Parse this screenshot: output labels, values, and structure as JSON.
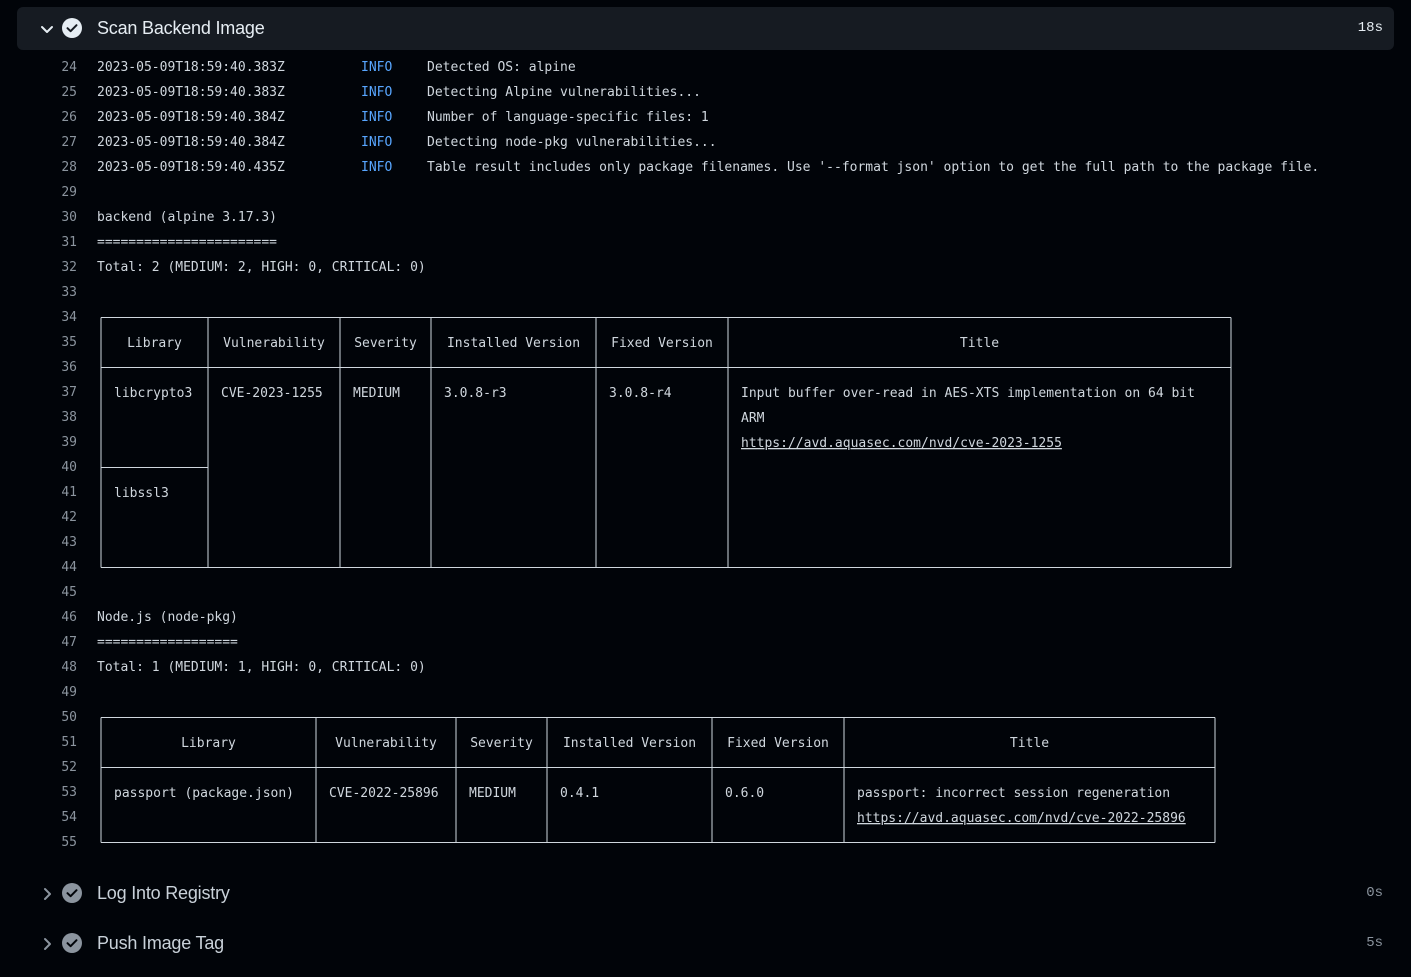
{
  "steps": {
    "active": {
      "title": "Scan Backend Image",
      "duration": "18s"
    },
    "next1": {
      "title": "Log Into Registry",
      "duration": "0s"
    },
    "next2": {
      "title": "Push Image Tag",
      "duration": "5s"
    }
  },
  "log": {
    "info_lines": [
      {
        "n": "24",
        "ts": "2023-05-09T18:59:40.383Z",
        "level": "INFO",
        "msg": "Detected OS: alpine"
      },
      {
        "n": "25",
        "ts": "2023-05-09T18:59:40.383Z",
        "level": "INFO",
        "msg": "Detecting Alpine vulnerabilities..."
      },
      {
        "n": "26",
        "ts": "2023-05-09T18:59:40.384Z",
        "level": "INFO",
        "msg": "Number of language-specific files: 1"
      },
      {
        "n": "27",
        "ts": "2023-05-09T18:59:40.384Z",
        "level": "INFO",
        "msg": "Detecting node-pkg vulnerabilities..."
      },
      {
        "n": "28",
        "ts": "2023-05-09T18:59:40.435Z",
        "level": "INFO",
        "msg": "Table result includes only package filenames. Use '--format json' option to get the full path to the package file."
      }
    ],
    "section1": {
      "heading": "backend (alpine 3.17.3)",
      "underline": "=======================",
      "total": "Total: 2 (MEDIUM: 2, HIGH: 0, CRITICAL: 0)",
      "headers": [
        "Library",
        "Vulnerability",
        "Severity",
        "Installed Version",
        "Fixed Version",
        "Title"
      ],
      "rows": [
        {
          "library": "libcrypto3",
          "vuln": "CVE-2023-1255",
          "severity": "MEDIUM",
          "installed": "3.0.8-r3",
          "fixed": "3.0.8-r4",
          "title1": "Input buffer over-read in AES-XTS implementation on 64 bit",
          "title2": "ARM",
          "link": "https://avd.aquasec.com/nvd/cve-2023-1255"
        },
        {
          "library": "libssl3"
        }
      ]
    },
    "section2": {
      "heading": "Node.js (node-pkg)",
      "underline": "==================",
      "total": "Total: 1 (MEDIUM: 1, HIGH: 0, CRITICAL: 0)",
      "headers": [
        "Library",
        "Vulnerability",
        "Severity",
        "Installed Version",
        "Fixed Version",
        "Title"
      ],
      "rows": [
        {
          "library": "passport (package.json)",
          "vuln": "CVE-2022-25896",
          "severity": "MEDIUM",
          "installed": "0.4.1",
          "fixed": "0.6.0",
          "title1": "passport: incorrect session regeneration",
          "link": "https://avd.aquasec.com/nvd/cve-2022-25896"
        }
      ]
    }
  },
  "colors": {
    "background": "#010409",
    "header_bg": "#161b22",
    "info": "#58a6ff",
    "text": "#d0d7de"
  }
}
